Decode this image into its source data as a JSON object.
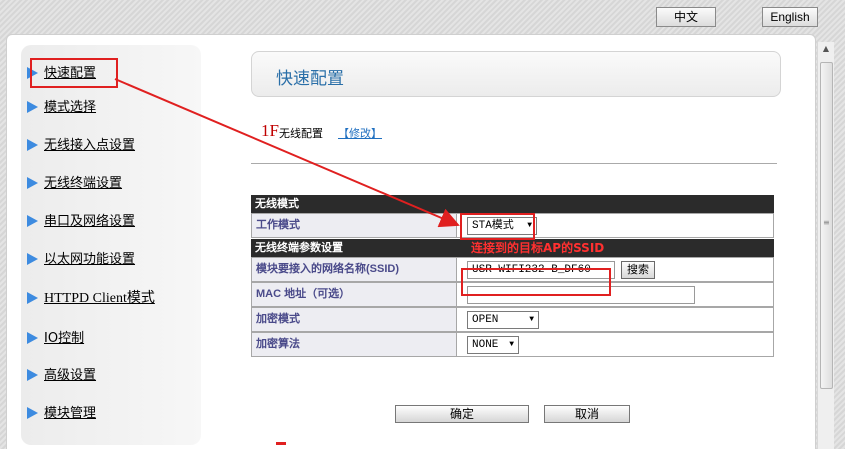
{
  "lang": {
    "zh_label": "中文",
    "en_label": "English"
  },
  "sidebar": {
    "items": [
      {
        "label": "快速配置",
        "selected": true
      },
      {
        "label": "模式选择"
      },
      {
        "label": "无线接入点设置"
      },
      {
        "label": "无线终端设置"
      },
      {
        "label": "串口及网络设置"
      },
      {
        "label": "以太网功能设置"
      },
      {
        "label": "HTTPD Client模式"
      },
      {
        "label": "IO控制"
      },
      {
        "label": "高级设置"
      },
      {
        "label": "模块管理"
      }
    ]
  },
  "main": {
    "title": "快速配置",
    "step": {
      "number": "1F",
      "text": "无线配置",
      "modify_link": "【修改】"
    },
    "wireless_mode": {
      "header": "无线模式",
      "work_mode_label": "工作模式",
      "work_mode_value": "STA模式"
    },
    "sta_params": {
      "header": "无线终端参数设置",
      "annotation": "连接到的目标AP的SSID",
      "ssid_label": "模块要接入的网络名称(SSID)",
      "ssid_value": "USR-WIFI232-B_DF60",
      "search_label": "搜索",
      "mac_label": "MAC 地址（可选）",
      "mac_value": "",
      "encrypt_mode_label": "加密模式",
      "encrypt_mode_value": "OPEN",
      "encrypt_alg_label": "加密算法",
      "encrypt_alg_value": "NONE"
    },
    "ok_label": "确定",
    "cancel_label": "取消"
  },
  "colors": {
    "highlight": "#e02020",
    "title": "#2a6fa8",
    "header_bg": "#2b2b2b",
    "annotation": "#ff3030"
  }
}
